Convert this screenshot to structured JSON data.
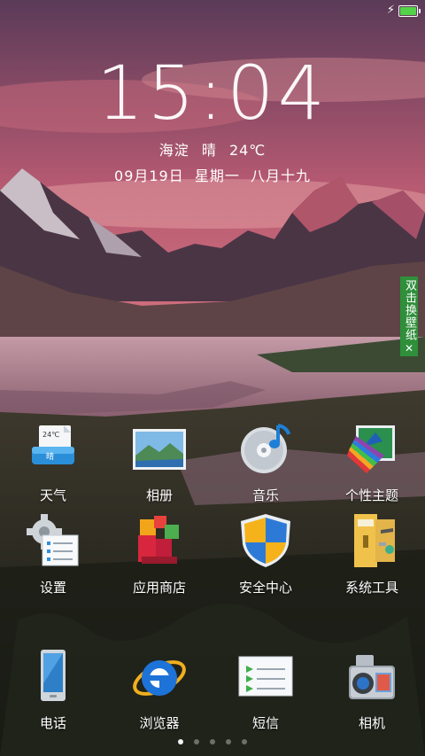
{
  "status": {
    "charging": true,
    "battery_level": 1.0
  },
  "clock": {
    "time": "15:04"
  },
  "weather": {
    "location": "海淀",
    "condition": "晴",
    "temp": "24℃"
  },
  "date": {
    "day": "09月19日",
    "weekday": "星期一",
    "lunar": "八月十九"
  },
  "wallpaper_tab": {
    "label": "双击换壁纸",
    "close": "✕"
  },
  "apps_row1": [
    {
      "label": "天气",
      "icon": "weather-icon"
    },
    {
      "label": "相册",
      "icon": "gallery-icon"
    },
    {
      "label": "音乐",
      "icon": "music-icon"
    },
    {
      "label": "个性主题",
      "icon": "theme-icon"
    }
  ],
  "apps_row2": [
    {
      "label": "设置",
      "icon": "settings-icon"
    },
    {
      "label": "应用商店",
      "icon": "app-store-icon"
    },
    {
      "label": "安全中心",
      "icon": "security-shield-icon"
    },
    {
      "label": "系统工具",
      "icon": "system-tools-icon"
    }
  ],
  "dock": [
    {
      "label": "电话",
      "icon": "phone-icon"
    },
    {
      "label": "浏览器",
      "icon": "browser-icon"
    },
    {
      "label": "短信",
      "icon": "messages-icon"
    },
    {
      "label": "相机",
      "icon": "camera-icon"
    }
  ],
  "weather_icon_text": {
    "temp": "24℃",
    "cond": "晴"
  },
  "pager": {
    "pages": 5,
    "current": 1
  },
  "colors": {
    "battery": "#54d24a",
    "wallpaper_tab": "#2f8f3a"
  }
}
